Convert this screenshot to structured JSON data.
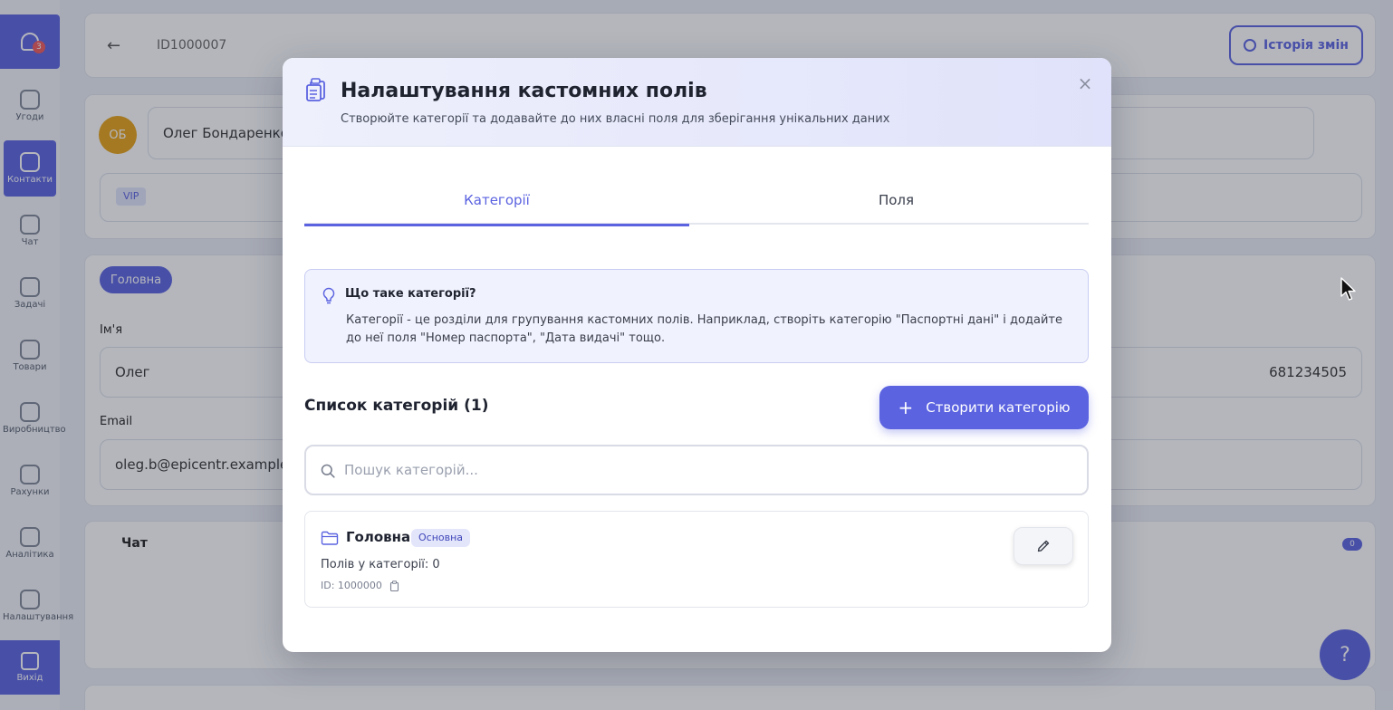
{
  "background": {
    "sidebar": {
      "notification_count": "3",
      "items": [
        {
          "label": "Угоди"
        },
        {
          "label": "Контакти"
        },
        {
          "label": "Чат"
        },
        {
          "label": "Задачі"
        },
        {
          "label": "Товари"
        },
        {
          "label": "Виробництво"
        },
        {
          "label": "Рахунки"
        },
        {
          "label": "Аналітика"
        },
        {
          "label": "Налаштування"
        }
      ],
      "logout_label": "Вихід"
    },
    "header": {
      "record_id": "ID1000007",
      "history_button": "Історія змін"
    },
    "contact": {
      "avatar_initials": "ОБ",
      "name": "Олег Бондаренко",
      "tag": "VIP"
    },
    "form": {
      "section_tab": "Головна",
      "name_label": "Ім'я",
      "name_value": "Олег",
      "phone_value": "681234505",
      "email_label": "Email",
      "email_value": "oleg.b@epicentr.example"
    },
    "chat_section": {
      "title": "Чат",
      "badge": "0"
    }
  },
  "modal": {
    "title": "Налаштування кастомних полів",
    "subtitle": "Створюйте категорії та додавайте до них власні поля для зберігання унікальних даних",
    "icons": {
      "header": "clipboard-icon",
      "close": "close-icon"
    },
    "tabs": [
      {
        "label": "Категорії",
        "active": true
      },
      {
        "label": "Поля",
        "active": false
      }
    ],
    "info": {
      "title": "Що таке категорії?",
      "text": "Категорії - це розділи для групування кастомних полів. Наприклад, створіть категорію \"Паспортні дані\" і додайте до неї поля \"Номер паспорта\", \"Дата видачі\" тощо."
    },
    "list": {
      "title": "Список категорій (1)",
      "create_button": "Створити категорію",
      "search_placeholder": "Пошук категорій...",
      "search_value": "",
      "categories": [
        {
          "name": "Головна",
          "badge": "Основна",
          "fields_count": "Полів у категорії: 0",
          "id": "ID: 1000000"
        }
      ]
    }
  },
  "colors": {
    "accent": "#5b63e0",
    "info_bg": "#f0f2fd",
    "badge_bg": "#e3e5fb",
    "overlay": "rgba(35,40,60,0.34)"
  }
}
